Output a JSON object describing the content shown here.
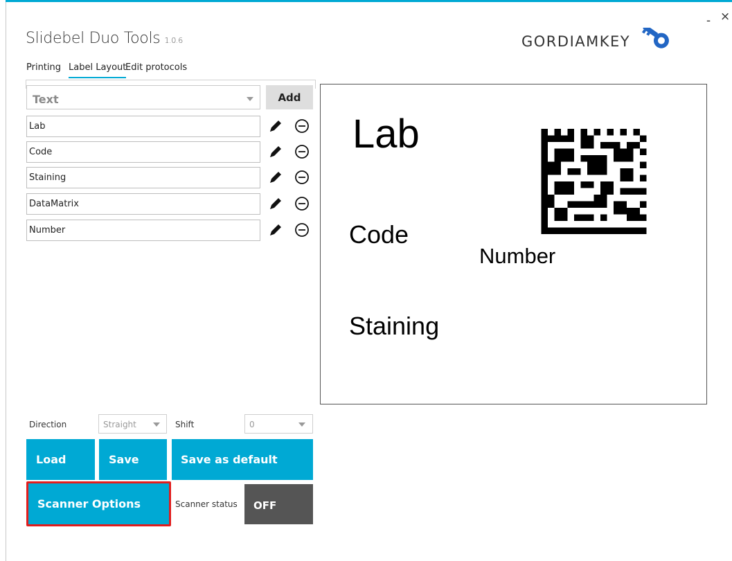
{
  "window": {
    "minimize_label": "-",
    "close_label": "×"
  },
  "app": {
    "title": "Slidebel Duo Tools",
    "version": "1.0.6",
    "logo_text": "GORDIAMKEY",
    "accent_color": "#00a9d4"
  },
  "tabs": [
    {
      "label": "Printing",
      "active": false
    },
    {
      "label": "Label Layout",
      "active": true
    },
    {
      "label": "Edit protocols",
      "active": false
    }
  ],
  "editor": {
    "type_select": {
      "value": "Text"
    },
    "add_label": "Add",
    "fields": [
      {
        "value": "Lab",
        "edit_icon": "pencil-icon",
        "remove_icon": "minus-circle-icon"
      },
      {
        "value": "Code",
        "edit_icon": "pencil-icon",
        "remove_icon": "minus-circle-icon"
      },
      {
        "value": "Staining",
        "edit_icon": "pencil-icon",
        "remove_icon": "minus-circle-icon"
      },
      {
        "value": "DataMatrix",
        "edit_icon": "pencil-icon",
        "remove_icon": "minus-circle-icon"
      },
      {
        "value": "Number",
        "edit_icon": "pencil-icon",
        "remove_icon": "minus-circle-icon"
      }
    ]
  },
  "preview": {
    "lab": "Lab",
    "code": "Code",
    "number": "Number",
    "staining": "Staining",
    "datamatrix_icon": "datamatrix-barcode"
  },
  "options": {
    "direction_label": "Direction",
    "direction_value": "Straight",
    "shift_label": "Shift",
    "shift_value": "0"
  },
  "buttons": {
    "load": "Load",
    "save": "Save",
    "save_default": "Save as default",
    "scanner_options": "Scanner Options"
  },
  "scanner": {
    "status_label": "Scanner status",
    "status_value": "OFF",
    "highlight_color": "#e11d1d"
  }
}
